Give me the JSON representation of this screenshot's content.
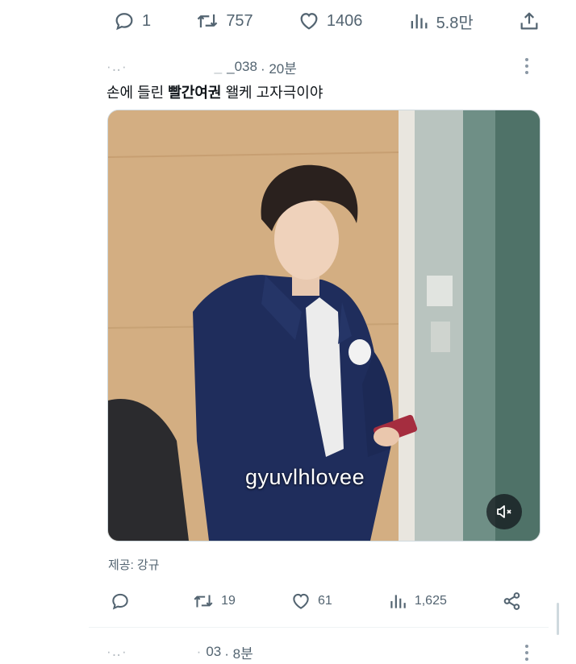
{
  "top_actions": {
    "reply_count": "1",
    "retweet_count": "757",
    "like_count": "1406",
    "view_count": "5.8만"
  },
  "tweet": {
    "author_handle_fragment": "_038",
    "time": "· 20분",
    "text_before": "손에 들린 ",
    "text_bold": "빨간여권",
    "text_after": " 왤케 고자극이야",
    "watermark": "gyuvlhlovee",
    "credit": "제공: 강규",
    "actions": {
      "reply_count": "",
      "retweet_count": "19",
      "like_count": "61",
      "view_count": "1,625"
    }
  },
  "next_tweet": {
    "author_handle_fragment": "03",
    "time": "· 8분"
  },
  "icons": {
    "reply": "reply-icon",
    "retweet": "retweet-icon",
    "like": "heart-icon",
    "views": "views-bar-chart-icon",
    "share": "share-upload-icon",
    "share_alt": "share-nodes-icon",
    "more": "more-kebab-icon",
    "mute": "speaker-muted-icon"
  },
  "colors": {
    "icon_gray": "#536471",
    "text_dark": "#0f1419",
    "jacket_navy": "#1f2d5c"
  }
}
